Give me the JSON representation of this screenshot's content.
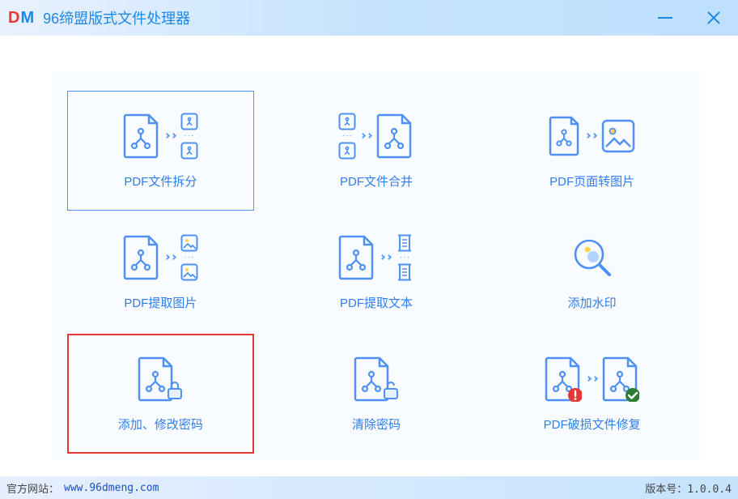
{
  "app": {
    "logo_d": "D",
    "logo_m": "M",
    "title": "96缔盟版式文件处理器"
  },
  "tools": {
    "split": {
      "label": "PDF文件拆分"
    },
    "merge": {
      "label": "PDF文件合并"
    },
    "to_image": {
      "label": "PDF页面转图片"
    },
    "extract_img": {
      "label": "PDF提取图片"
    },
    "extract_txt": {
      "label": "PDF提取文本"
    },
    "watermark": {
      "label": "添加水印"
    },
    "password": {
      "label": "添加、修改密码"
    },
    "clear_pwd": {
      "label": "清除密码"
    },
    "repair": {
      "label": "PDF破损文件修复"
    }
  },
  "footer": {
    "site_label": "官方网站：",
    "site_url": "www.96dmeng.com",
    "version_label": "版本号：",
    "version": "1.0.0.4"
  }
}
